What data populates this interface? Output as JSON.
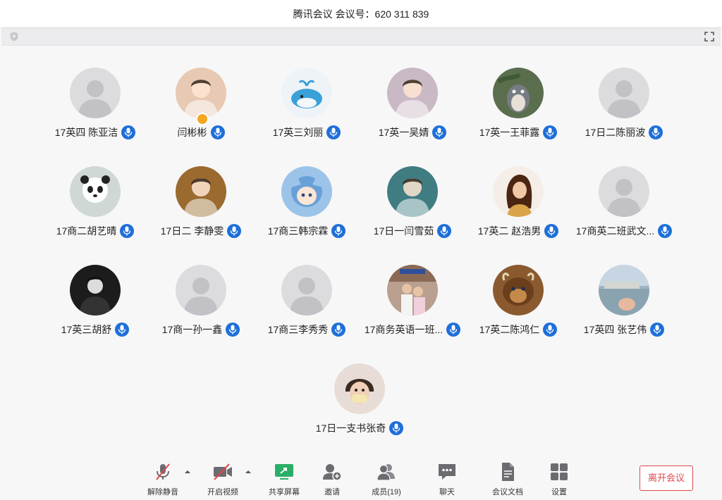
{
  "window": {
    "title": "腾讯会议 会议号：620 311 839"
  },
  "participants": [
    {
      "name": "17英四 陈亚洁",
      "avatar": "default-avatar"
    },
    {
      "name": "闫彬彬",
      "avatar": "baby-photo-avatar",
      "host": true
    },
    {
      "name": "17英三刘丽",
      "avatar": "whale-cartoon-avatar"
    },
    {
      "name": "17英一吴婧",
      "avatar": "child-photo-avatar"
    },
    {
      "name": "17英一王菲露",
      "avatar": "totoro-avatar"
    },
    {
      "name": "17日二陈丽波",
      "avatar": "default-avatar"
    },
    {
      "name": "17商二胡艺晴",
      "avatar": "panda-avatar"
    },
    {
      "name": "17日二 李静雯",
      "avatar": "woman-photo-avatar"
    },
    {
      "name": "17商三韩宗霖",
      "avatar": "anime-avatar"
    },
    {
      "name": "17日一闫雪茹",
      "avatar": "man-photo-avatar"
    },
    {
      "name": "17英二 赵浩男",
      "avatar": "belle-cartoon-avatar"
    },
    {
      "name": "17商英二班武文...",
      "avatar": "default-avatar"
    },
    {
      "name": "17英三胡舒",
      "avatar": "dark-portrait-avatar"
    },
    {
      "name": "17商一孙一鑫",
      "avatar": "default-avatar"
    },
    {
      "name": "17商三李秀秀",
      "avatar": "default-avatar"
    },
    {
      "name": "17商务英语一班...",
      "avatar": "group-photo-avatar"
    },
    {
      "name": "17英二陈鸿仁",
      "avatar": "beast-cartoon-avatar"
    },
    {
      "name": "17英四 张艺伟",
      "avatar": "landscape-avatar"
    },
    {
      "name": "17日一支书张奇",
      "avatar": "kid-mask-avatar"
    }
  ],
  "toolbar": {
    "unmute": "解除静音",
    "start_video": "开启视频",
    "share_screen": "共享屏幕",
    "invite": "邀请",
    "members": "成员(19)",
    "chat": "聊天",
    "docs": "会议文档",
    "settings": "设置",
    "leave": "离开会议"
  },
  "colors": {
    "mic_badge": "#1e6fd9",
    "leave_red": "#e0474c",
    "share_green": "#2aae67",
    "muted_red": "#e0474c"
  }
}
